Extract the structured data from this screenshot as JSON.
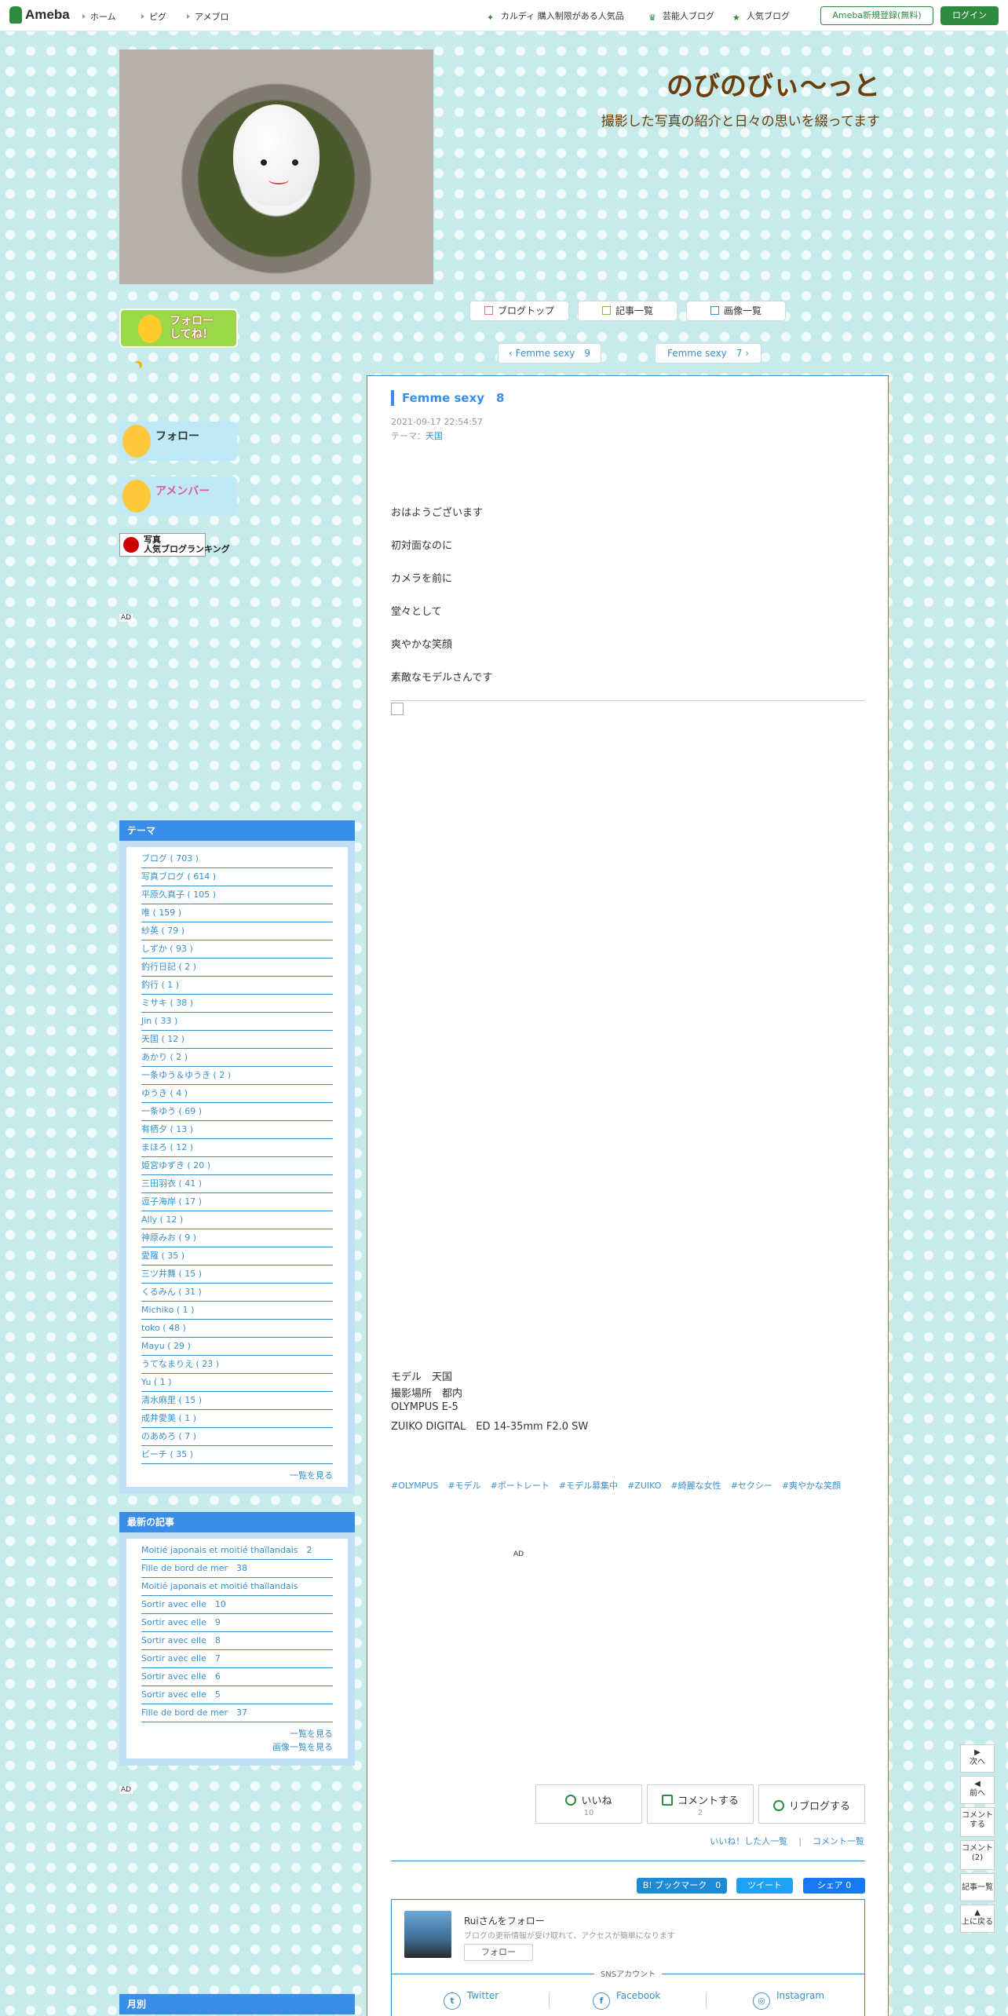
{
  "topbar": {
    "logo": "Ameba",
    "nav": [
      "ホーム",
      "ピグ",
      "アメブロ"
    ],
    "links": [
      "カルディ 購入制限がある人気品",
      "芸能人ブログ",
      "人気ブログ"
    ],
    "register": "Ameba新規登録(無料)",
    "login": "ログイン"
  },
  "blog": {
    "title": "のびのびぃ～っと",
    "description": "撮影した写真の紹介と日々の思いを綴ってます"
  },
  "subnav": {
    "top": "ブログトップ",
    "list": "記事一覧",
    "images": "画像一覧"
  },
  "pager": {
    "prev": "Femme sexy　9",
    "next": "Femme sexy　7"
  },
  "sidebar": {
    "follow_badge": "フォロー\nしてね！",
    "follow_now": "フォロー",
    "ameba_member": "アメンバー",
    "photo_rank": "写真\n人気ブログランキング",
    "ad": "AD",
    "theme_header": "テーマ",
    "themes": [
      "ブログ ( 703 )",
      "写真ブログ ( 614 )",
      "平原久真子 ( 105 )",
      "唯 ( 159 )",
      "紗英 ( 79 )",
      "しずか ( 93 )",
      "釣行日記 ( 2 )",
      "釣行 ( 1 )",
      "ミサキ ( 38 )",
      "Jin ( 33 )",
      "天国 ( 12 )",
      "あかり ( 2 )",
      "一条ゆう＆ゆうき ( 2 )",
      "ゆうき ( 4 )",
      "一条ゆう ( 69 )",
      "有栖夕 ( 13 )",
      "まほろ ( 12 )",
      "姫宮ゆずき ( 20 )",
      "三田羽衣 ( 41 )",
      "逗子海岸 ( 17 )",
      "Ally ( 12 )",
      "神原みお ( 9 )",
      "愛羅 ( 35 )",
      "三ツ井舞 ( 15 )",
      "くるみん ( 31 )",
      "Michiko ( 1 )",
      "toko ( 48 )",
      "Mayu ( 29 )",
      "うてなまりえ ( 23 )",
      "Yu ( 1 )",
      "清水麻里 ( 15 )",
      "成井愛美 ( 1 )",
      "のあめろ ( 7 )",
      "ビーチ ( 35 )"
    ],
    "theme_more": "一覧を見る",
    "recent_header": "最新の記事",
    "recent": [
      "Moitié japonais et moitié thaïlandais　2",
      "Fille de bord de mer　38",
      "Moitié japonais et moitié thaïlandais",
      "Sortir avec elle　10",
      "Sortir avec elle　9",
      "Sortir avec elle　8",
      "Sortir avec elle　7",
      "Sortir avec elle　6",
      "Sortir avec elle　5",
      "Fille de bord de mer　37"
    ],
    "recent_more": "一覧を見る",
    "recent_images": "画像一覧を見る",
    "monthly_header": "月別"
  },
  "entry": {
    "title": "Femme sexy　8",
    "date": "2021-09-17 22:54:57",
    "theme_label": "テーマ：",
    "theme": "天国",
    "lines": [
      "おはようございます",
      "初対面なのに",
      "カメラを前に",
      "堂々として",
      "爽やかな笑顔",
      "素敵なモデルさんです"
    ],
    "credits": [
      "モデル　天国",
      "撮影場所　都内",
      "OLYMPUS E-5",
      "ZUIKO DIGITAL　ED 14-35mm F2.0 SW"
    ],
    "tags": [
      "#OLYMPUS",
      "#モデル",
      "#ポートレート",
      "#モデル募集中",
      "#ZUIKO",
      "#綺麗な女性",
      "#セクシー",
      "#爽やかな笑顔"
    ],
    "ad": "AD",
    "like_label": "いいね",
    "like_count": "10",
    "comment_label": "コメントする",
    "comment_count": "2",
    "reblog_label": "リブログする",
    "liked_list": "いいね！した人一覧",
    "comment_list": "コメント一覧",
    "hatena": "B! ブックマーク　0",
    "tweet": "ツイート",
    "fb_share": "シェア 0"
  },
  "followbox": {
    "name": "Ruiさんをフォロー",
    "desc": "ブログの更新情報が受け取れて、アクセスが簡単になります",
    "button": "フォロー",
    "sns_label": "SNSアカウント",
    "twitter": "Twitter",
    "facebook": "Facebook",
    "instagram": "Instagram"
  },
  "floatnav": {
    "next": "次へ",
    "prev": "前へ",
    "comment": "コメント\nする",
    "comments": "コメント\n(2)",
    "list": "記事一覧",
    "top": "上に戻る"
  },
  "colors": {
    "accent": "#3b8ee8",
    "ameba_green": "#2d8a3e",
    "title_brown": "#6b3e0b",
    "link": "#3a8fc7"
  }
}
